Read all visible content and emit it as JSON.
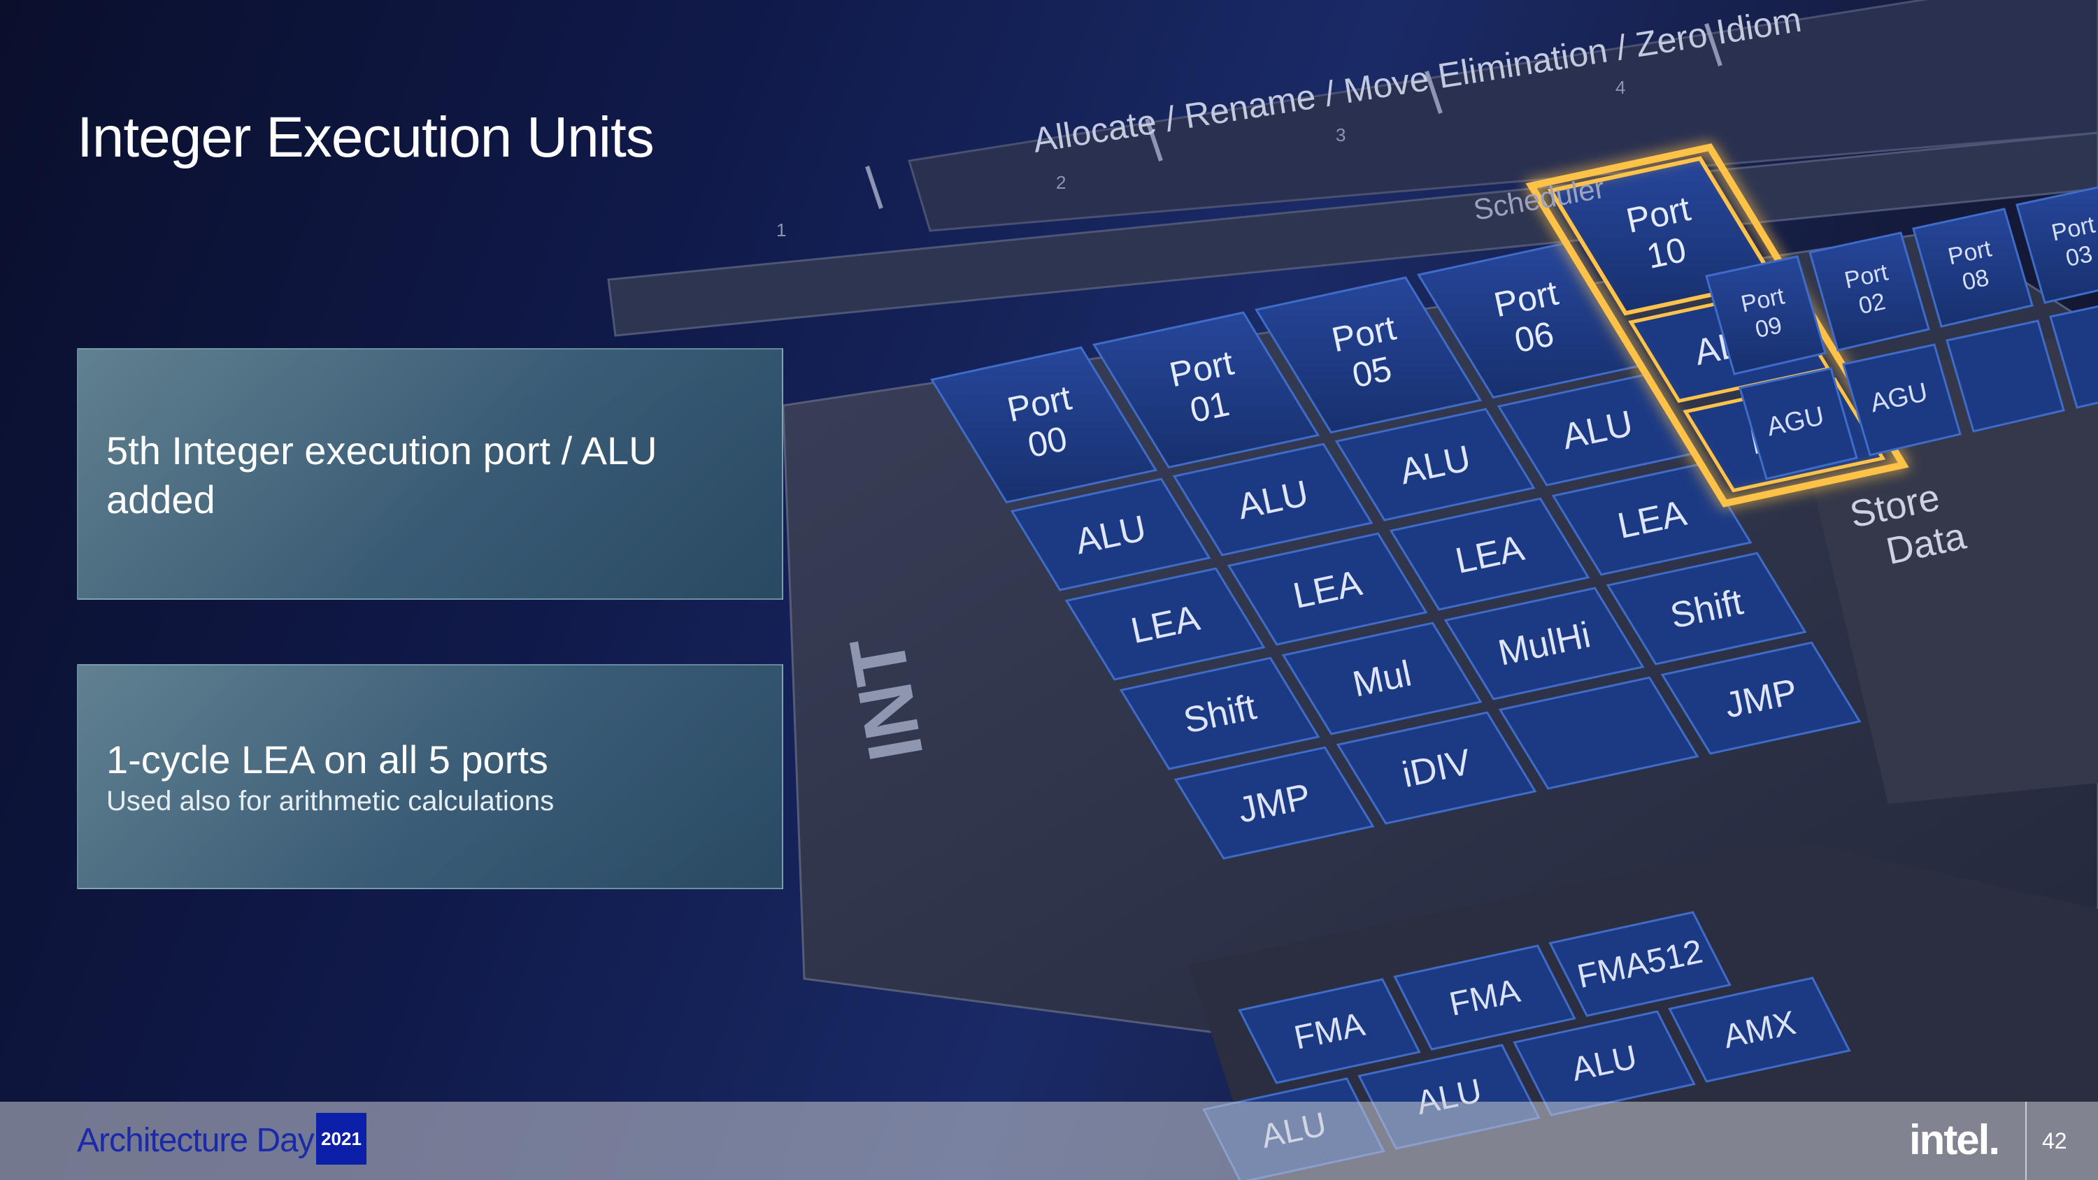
{
  "slide": {
    "title": "Integer Execution Units",
    "page_number": "42"
  },
  "callouts": [
    {
      "heading": "5th Integer execution port / ALU added",
      "subtext": ""
    },
    {
      "heading": "1-cycle LEA on all 5 ports",
      "subtext": "Used also for arithmetic calculations"
    }
  ],
  "footer": {
    "brand": "Architecture Day",
    "year": "2021",
    "logo": "intel."
  },
  "diagram": {
    "pipeline_label": "Allocate / Rename / Move Elimination / Zero Idiom",
    "pipeline_ticks": [
      "1",
      "2",
      "3",
      "4"
    ],
    "scheduler_label": "Scheduler",
    "int_label": "INT",
    "store_data_label": "Store Data",
    "agu_label": "AGU",
    "int_columns": [
      {
        "port": "Port 00",
        "units": [
          "ALU",
          "LEA",
          "Shift",
          "JMP"
        ]
      },
      {
        "port": "Port 01",
        "units": [
          "ALU",
          "LEA",
          "Mul",
          "iDIV"
        ]
      },
      {
        "port": "Port 05",
        "units": [
          "ALU",
          "LEA",
          "MulHi",
          ""
        ]
      },
      {
        "port": "Port 06",
        "units": [
          "ALU",
          "LEA",
          "Shift",
          "JMP"
        ]
      },
      {
        "port": "Port 10",
        "units": [
          "ALU",
          "LEA"
        ],
        "highlighted": true
      }
    ],
    "other_ports": [
      "Port 09",
      "Port 02",
      "Port 08",
      "Port 03"
    ],
    "vector_units": [
      "FMA",
      "FMA",
      "FMA512",
      "ALU",
      "ALU",
      "ALU",
      "AMX"
    ],
    "colors": {
      "cell": "#1e3c8c",
      "cell_border": "#3f6cc8",
      "highlight": "#ffc24a"
    }
  }
}
